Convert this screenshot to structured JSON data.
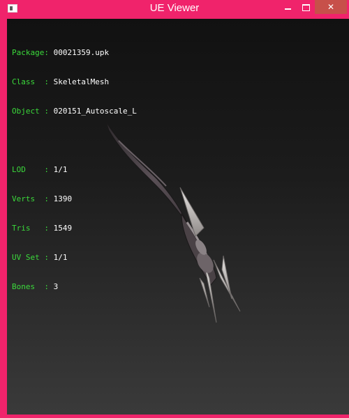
{
  "window": {
    "title": "UE Viewer",
    "accent": "#f0236b",
    "close_hover": "#c7504a"
  },
  "controls": {
    "minimize": "minimize-icon",
    "maximize": "maximize-icon",
    "close": "✕"
  },
  "info": {
    "object_rows": [
      {
        "label": "Package: ",
        "value": "00021359.upk"
      },
      {
        "label": "Class  : ",
        "value": "SkeletalMesh"
      },
      {
        "label": "Object : ",
        "value": "020151_Autoscale_L"
      }
    ],
    "mesh_rows": [
      {
        "label": "LOD    : ",
        "value": "1/1"
      },
      {
        "label": "Verts  : ",
        "value": "1390"
      },
      {
        "label": "Tris   : ",
        "value": "1549"
      },
      {
        "label": "UV Set : ",
        "value": "1/1"
      },
      {
        "label": "Bones  : ",
        "value": "3"
      }
    ],
    "label_color": "#3bd93b",
    "value_color": "#ffffff"
  }
}
